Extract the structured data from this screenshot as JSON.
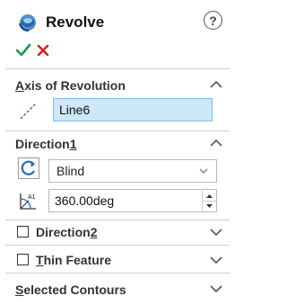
{
  "header": {
    "title": "Revolve",
    "help_glyph": "?"
  },
  "actions": {
    "ok_icon": "check-icon",
    "cancel_icon": "x-icon"
  },
  "axis_section": {
    "label_first": "A",
    "label_rest": "xis of Revolution",
    "value": "Line6"
  },
  "direction1": {
    "label": "Direction",
    "number": "1",
    "end_condition": "Blind",
    "angle": "360.00deg",
    "angle_icon_text": "A1"
  },
  "direction2": {
    "label": "Direction",
    "number": "2",
    "checked": false
  },
  "thin_feature": {
    "label_first": "T",
    "label_rest": "hin Feature",
    "checked": false
  },
  "selected_contours": {
    "label_first": "S",
    "label_rest": "elected Contours"
  },
  "colors": {
    "accent_green": "#1e9b3a",
    "cancel_red": "#d52222",
    "field_highlight": "#cde8f8",
    "icon_blue": "#1f6fb8"
  }
}
